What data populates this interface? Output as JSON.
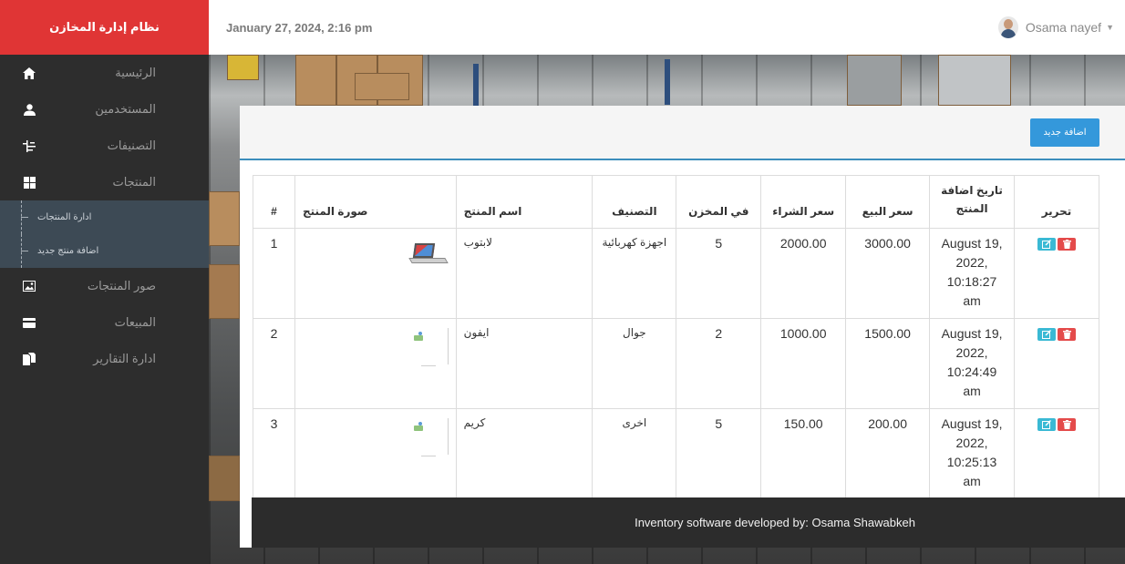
{
  "sidebar": {
    "brand": "نظام إدارة المخازن",
    "items": [
      {
        "label": "الرئيسية",
        "icon": "home-icon"
      },
      {
        "label": "المستخدمين",
        "icon": "user-icon"
      },
      {
        "label": "التصنيفات",
        "icon": "tree-icon"
      },
      {
        "label": "المنتجات",
        "icon": "grid-icon"
      }
    ],
    "submenu": [
      {
        "label": "ادارة المنتجات"
      },
      {
        "label": "اضافة منتج جديد"
      }
    ],
    "items2": [
      {
        "label": "صور المنتجات",
        "icon": "image-icon"
      },
      {
        "label": "المبيعات",
        "icon": "card-icon"
      },
      {
        "label": "ادارة التقارير",
        "icon": "files-icon"
      }
    ]
  },
  "header": {
    "datetime": "January 27, 2024, 2:16 pm",
    "user_name": "Osama nayef"
  },
  "panel": {
    "add_button": "اضافة جديد"
  },
  "table": {
    "headers": {
      "num": "#",
      "image": "صورة المنتج",
      "name": "اسم المنتج",
      "category": "التصنيف",
      "stock": "في المخزن",
      "buy_price": "سعر الشراء",
      "sell_price": "سعر البيع",
      "date_added": "تاريخ اضافة المنتج",
      "edit": "تحرير"
    },
    "rows": [
      {
        "num": "1",
        "name": "لابتوب",
        "category": "اجهزة كهربائية",
        "stock": "5",
        "buy_price": "2000.00",
        "sell_price": "3000.00",
        "date_added": "August 19, 2022, 10:18:27 am"
      },
      {
        "num": "2",
        "name": "ايفون",
        "category": "جوال",
        "stock": "2",
        "buy_price": "1000.00",
        "sell_price": "1500.00",
        "date_added": "August 19, 2022, 10:24:49 am"
      },
      {
        "num": "3",
        "name": "كريم",
        "category": "اخرى",
        "stock": "5",
        "buy_price": "150.00",
        "sell_price": "200.00",
        "date_added": "August 19, 2022, 10:25:13 am"
      }
    ]
  },
  "footer": {
    "text": "Inventory software developed by: Osama Shawabkeh"
  },
  "colors": {
    "brand_red": "#e03535",
    "accent_blue": "#3498db",
    "edit_cyan": "#3ab9d4",
    "delete_red": "#e44b4b"
  }
}
